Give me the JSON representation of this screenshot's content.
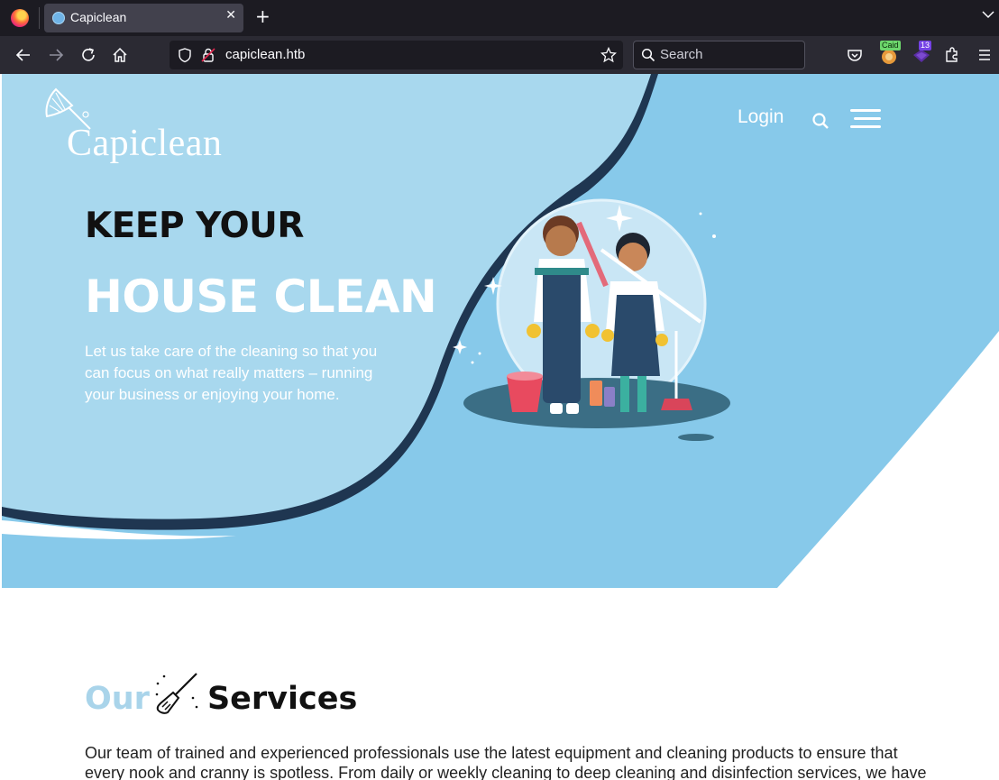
{
  "browser": {
    "tab_title": "Capiclean",
    "tab_close": "✕",
    "new_tab": "+",
    "url": "capiclean.htb",
    "search_placeholder": "Search",
    "extensions": [
      {
        "icon": "caido-extension-icon",
        "badge": "Caid"
      },
      {
        "icon": "hacktools-extension-icon",
        "badge": "13"
      }
    ]
  },
  "site": {
    "logo_text": "Capiclean",
    "nav": {
      "login_label": "Login"
    },
    "hero": {
      "heading_line1": "KEEP YOUR",
      "heading_line2": "HOUSE CLEAN",
      "description": "Let us take care of the cleaning so that you can focus on what really matters – running your business or enjoying your home."
    },
    "services": {
      "title_part1": "Our",
      "title_part2": "Services",
      "description": "Our team of trained and experienced professionals use the latest equipment and cleaning products to ensure that every nook and cranny is spotless. From daily or weekly cleaning to deep cleaning and disinfection services, we have"
    }
  },
  "colors": {
    "hero_light_blue": "#a8d8ee",
    "hero_blue": "#87c9ea",
    "wave_shadow": "#1f3651",
    "accent_light": "#a9d4ea",
    "browser_dark": "#1c1b22",
    "browser_toolbar": "#2b2a33"
  }
}
